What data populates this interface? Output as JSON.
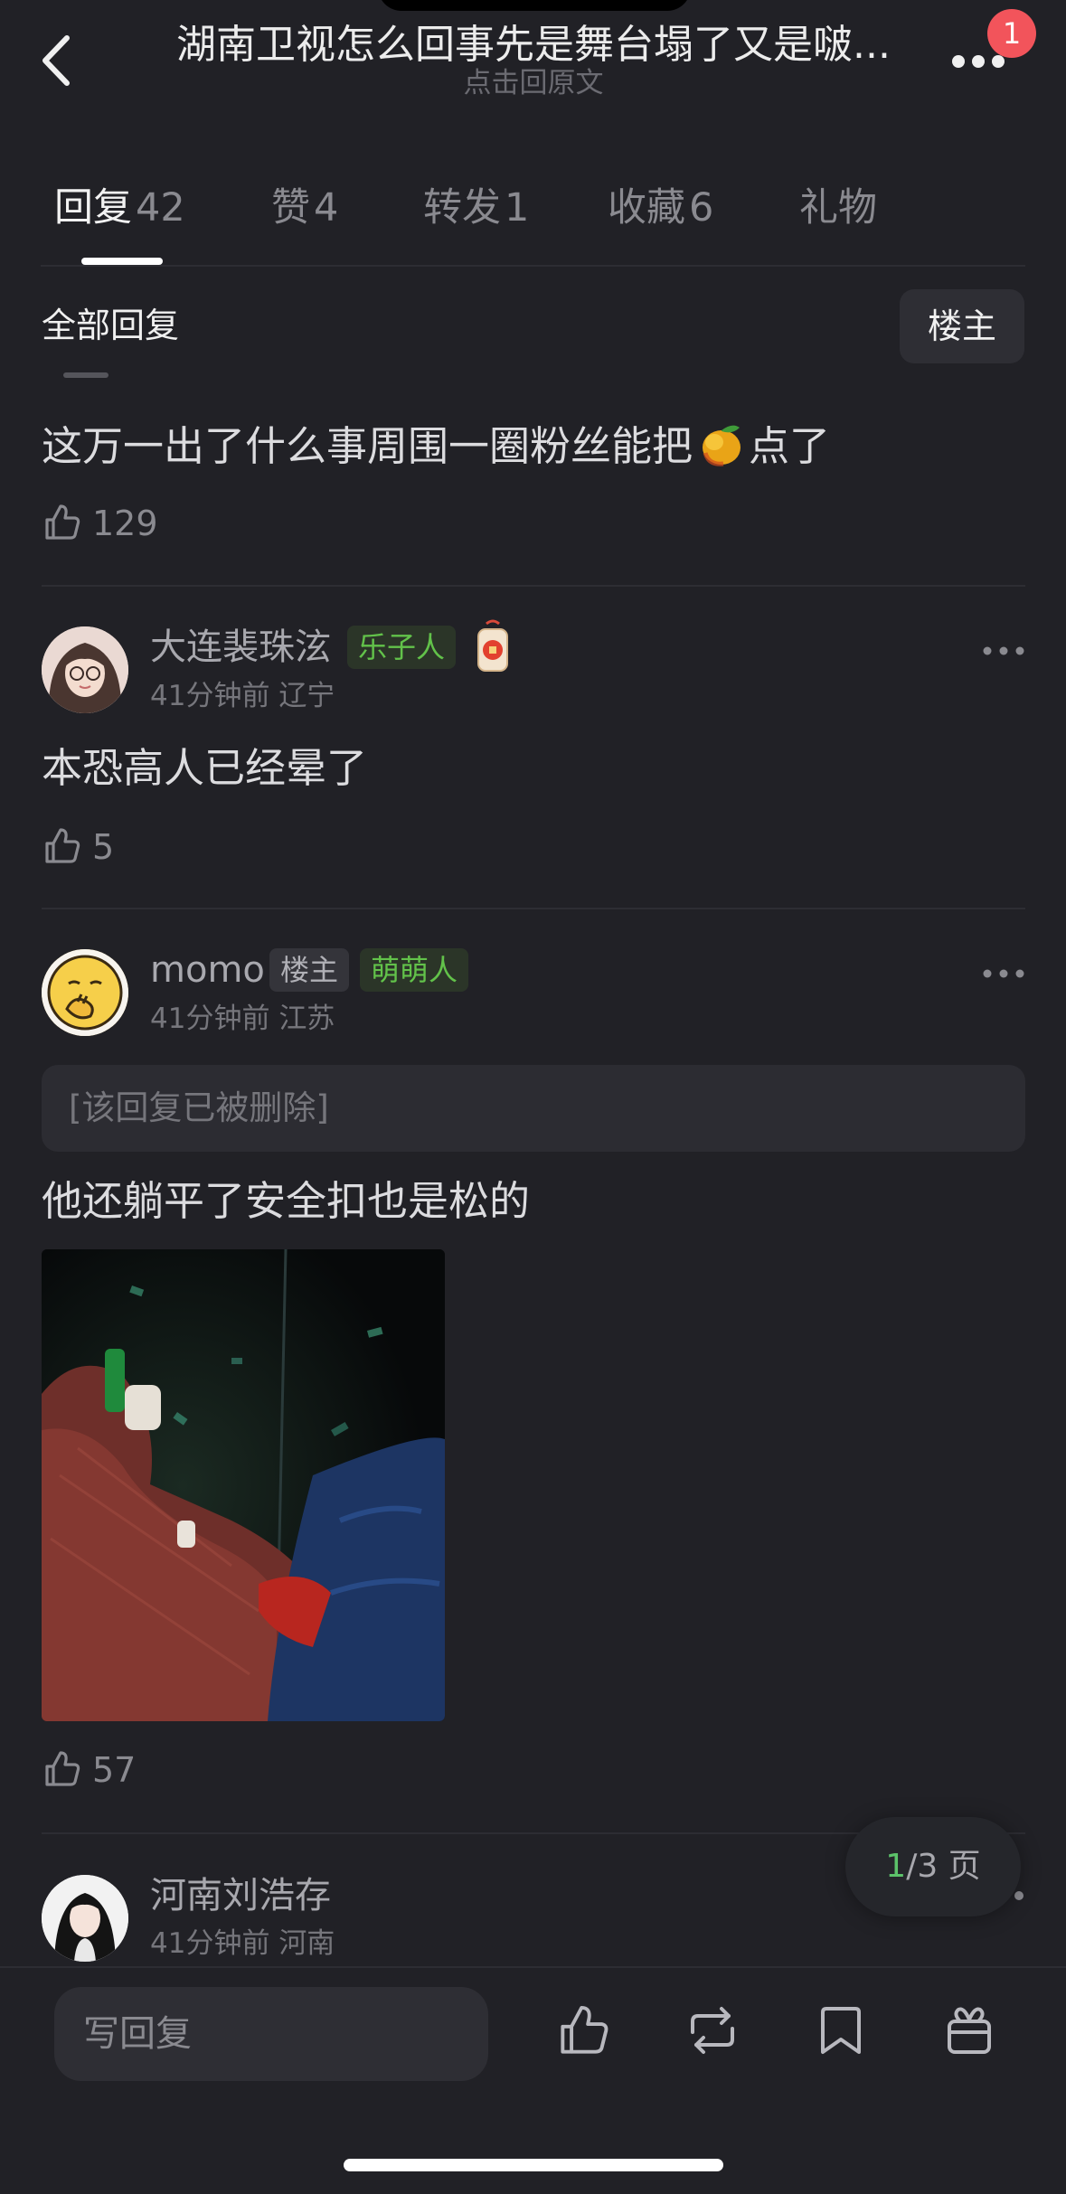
{
  "header": {
    "title": "湖南卫视怎么回事先是舞台塌了又是啵...",
    "subtitle": "点击回原文",
    "notification_badge": "1"
  },
  "tabs": [
    {
      "label": "回复",
      "count": "42",
      "active": true
    },
    {
      "label": "赞",
      "count": "4",
      "active": false
    },
    {
      "label": "转发",
      "count": "1",
      "active": false
    },
    {
      "label": "收藏",
      "count": "6",
      "active": false
    },
    {
      "label": "礼物",
      "count": "",
      "active": false
    }
  ],
  "filter": {
    "all_replies_label": "全部回复",
    "op_button_label": "楼主"
  },
  "comments": [
    {
      "text_before_emoji": "这万一出了什么事周围一圈粉丝能把",
      "emoji": "mango",
      "text_after_emoji": "点了",
      "likes": "129"
    },
    {
      "username": "大连裴珠泫",
      "tags": [
        "乐子人"
      ],
      "time": "41分钟前",
      "location": "辽宁",
      "text": "本恐高人已经晕了",
      "likes": "5"
    },
    {
      "username": "momo",
      "tags": [
        "楼主",
        "萌萌人"
      ],
      "time": "41分钟前",
      "location": "江苏",
      "quoted": "[该回复已被删除]",
      "text": "他还躺平了安全扣也是松的",
      "likes": "57"
    },
    {
      "username": "河南刘浩存",
      "time": "41分钟前",
      "location": "河南"
    }
  ],
  "pagination": {
    "current": "1",
    "total_text": "/3 页"
  },
  "bottom_bar": {
    "reply_placeholder": "写回复",
    "icons": [
      "like-icon",
      "repost-icon",
      "bookmark-icon",
      "gift-icon"
    ]
  },
  "colors": {
    "background": "#212126",
    "tag_green": "#62c24a",
    "badge_red": "#f2545b",
    "page_current": "#5cc26a"
  }
}
